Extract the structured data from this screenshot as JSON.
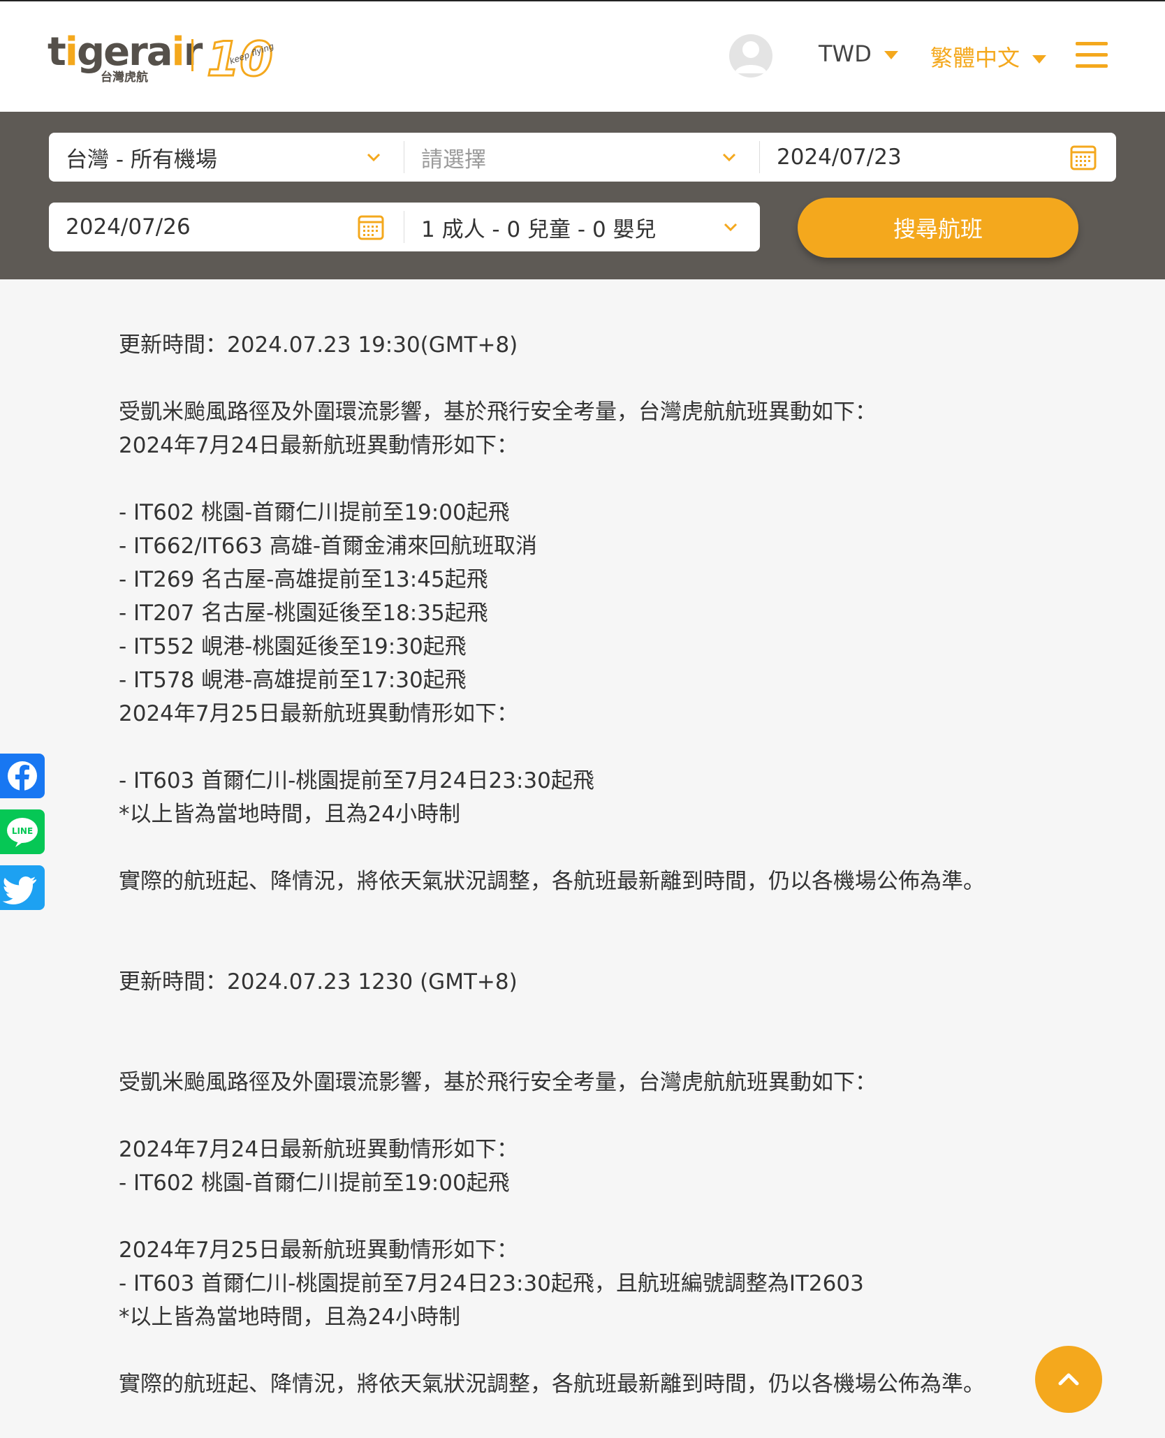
{
  "header": {
    "logo_text": "tigerair",
    "logo_sub": "台灣虎航",
    "badge_text": "10",
    "badge_tag": "keep flying",
    "currency": "TWD",
    "language": "繁體中文"
  },
  "search": {
    "origin": "台灣 - 所有機場",
    "destination_placeholder": "請選擇",
    "depart_date": "2024/07/23",
    "return_date": "2024/07/26",
    "passengers": "1 成人 - 0 兒童 - 0 嬰兒",
    "search_button": "搜尋航班"
  },
  "notice": {
    "update1": "更新時間：2024.07.23 19:30(GMT+8)",
    "intro1": "受凱米颱風路徑及外圍環流影響，基於飛行安全考量，台灣虎航航班異動如下：",
    "day24_heading1": "2024年7月24日最新航班異動情形如下：",
    "day24_items": [
      "- IT602 桃園-首爾仁川提前至19:00起飛",
      "- IT662/IT663 高雄-首爾金浦來回航班取消",
      "- IT269 名古屋-高雄提前至13:45起飛",
      "- IT207 名古屋-桃園延後至18:35起飛",
      "- IT552 峴港-桃園延後至19:30起飛",
      "- IT578 峴港-高雄提前至17:30起飛"
    ],
    "day25_heading1": "2024年7月25日最新航班異動情形如下：",
    "day25_item1": "- IT603 首爾仁川-桃園提前至7月24日23:30起飛",
    "local_time_note1": "*以上皆為當地時間，且為24小時制",
    "closing1": "實際的航班起、降情況，將依天氣狀況調整，各航班最新離到時間，仍以各機場公佈為準。",
    "update2": "更新時間：2024.07.23 1230 (GMT+8)",
    "intro2": "受凱米颱風路徑及外圍環流影響，基於飛行安全考量，台灣虎航航班異動如下：",
    "day24_heading2": "2024年7月24日最新航班異動情形如下：",
    "day24_item2": "- IT602 桃園-首爾仁川提前至19:00起飛",
    "day25_heading2": "2024年7月25日最新航班異動情形如下：",
    "day25_item2": "- IT603 首爾仁川-桃園提前至7月24日23:30起飛，且航班編號調整為IT2603",
    "local_time_note2": "*以上皆為當地時間，且為24小時制",
    "closing2": "實際的航班起、降情況，將依天氣狀況調整，各航班最新離到時間，仍以各機場公佈為準。"
  },
  "social": {
    "line_label": "LINE"
  },
  "colors": {
    "accent": "#f4a81d",
    "search_panel": "#5e5a55",
    "facebook": "#1877f2",
    "line": "#06c755",
    "twitter": "#1da1f2"
  }
}
